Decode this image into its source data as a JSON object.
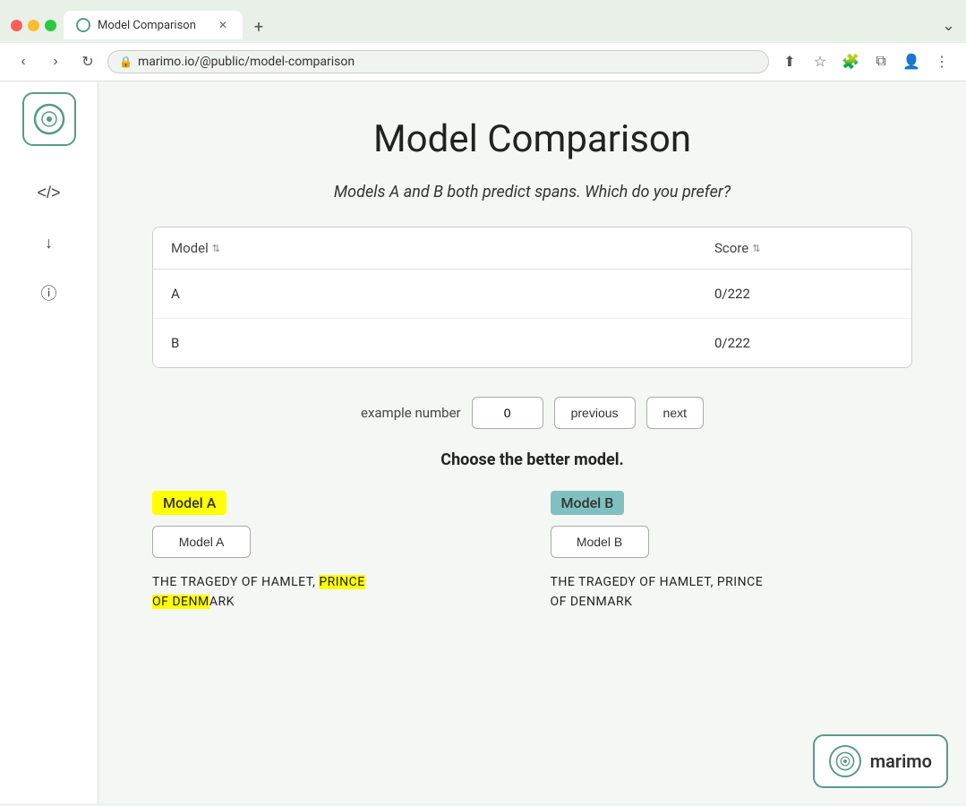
{
  "browser": {
    "tab_title": "Model Comparison",
    "url": "marimo.io/@public/model-comparison",
    "new_tab_label": "+"
  },
  "page": {
    "title": "Model Comparison",
    "subtitle": "Models A and B both predict spans. Which do you prefer?"
  },
  "table": {
    "columns": [
      {
        "label": "Model",
        "key": "model"
      },
      {
        "label": "Score",
        "key": "score"
      }
    ],
    "rows": [
      {
        "model": "A",
        "score": "0/222"
      },
      {
        "model": "B",
        "score": "0/222"
      }
    ]
  },
  "controls": {
    "example_label": "example number",
    "example_value": "0",
    "previous_label": "previous",
    "next_label": "next"
  },
  "comparison": {
    "choose_title": "Choose the better model.",
    "model_a_label": "Model A",
    "model_b_label": "Model B",
    "model_a_btn": "Model A",
    "model_b_btn": "Model B",
    "model_a_text_before_highlight": "THE TRAGEDY OF HAMLET, ",
    "model_a_highlight1": "PRINCE",
    "model_a_highlight2": "OF DENM",
    "model_a_text_after": "ARK",
    "model_a_text_between": " ",
    "model_b_text": "THE TRAGEDY OF HAMLET, PRINCE OF DENMARK"
  },
  "sidebar": {
    "code_icon": "</>",
    "download_icon": "↓",
    "info_icon": "ⓘ"
  },
  "watermark": {
    "brand": "marimo"
  }
}
